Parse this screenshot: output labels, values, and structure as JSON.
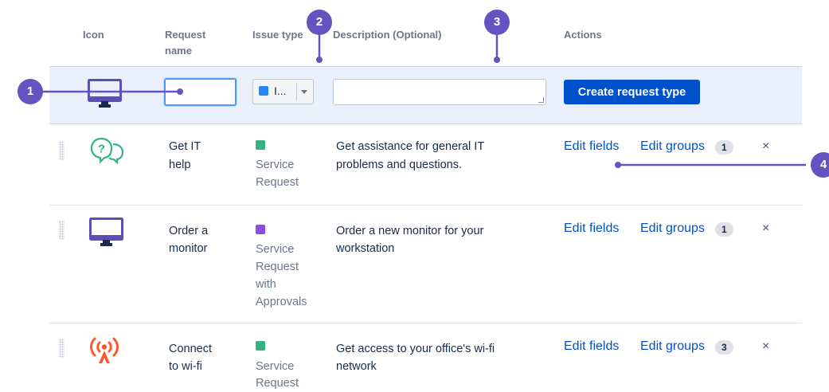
{
  "headers": {
    "icon": "Icon",
    "request_name_line1": "Request",
    "request_name_line2": "name",
    "issue_type": "Issue type",
    "description": "Description (Optional)",
    "actions": "Actions"
  },
  "create_row": {
    "issue_type_selected": "I...",
    "create_button_label": "Create request type"
  },
  "callouts": [
    "1",
    "2",
    "3",
    "4"
  ],
  "rows": [
    {
      "icon": "chat-question-icon",
      "name_line1": "Get IT",
      "name_line2": "help",
      "type_lines": [
        "Service",
        "Request"
      ],
      "type_icon_color": "#36b37e",
      "desc_line1": "Get assistance for general IT",
      "desc_line2": "problems and questions.",
      "edit_fields": "Edit fields",
      "edit_groups": "Edit groups",
      "group_count": "1",
      "remove": "×"
    },
    {
      "icon": "monitor-icon",
      "name_line1": "Order a",
      "name_line2": "monitor",
      "type_lines": [
        "Service",
        "Request",
        "with",
        "Approvals"
      ],
      "type_icon_color": "#8f4bdb",
      "desc_line1": "Order a new monitor for your",
      "desc_line2": "workstation",
      "edit_fields": "Edit fields",
      "edit_groups": "Edit groups",
      "group_count": "1",
      "remove": "×"
    },
    {
      "icon": "wifi-signal-icon",
      "name_line1": "Connect",
      "name_line2": "to wi-fi",
      "type_lines": [
        "Service",
        "Request"
      ],
      "type_icon_color": "#36b37e",
      "desc_line1": "Get access to your office's wi-fi",
      "desc_line2": "network",
      "edit_fields": "Edit fields",
      "edit_groups": "Edit groups",
      "group_count": "3",
      "remove": "×"
    }
  ],
  "colors": {
    "accent": "#0052cc",
    "callout": "#6554c0",
    "monitor": "#5e4db2",
    "chat_icon": "#36b37e",
    "wifi_icon": "#ff5630"
  }
}
